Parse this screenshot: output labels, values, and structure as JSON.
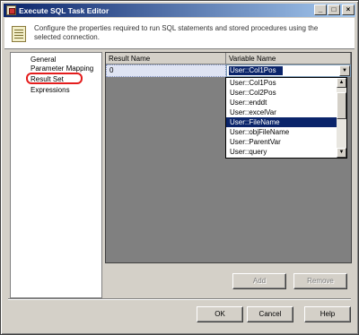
{
  "window": {
    "title": "Execute SQL Task Editor",
    "controls": {
      "minimize": "_",
      "maximize": "□",
      "close": "×"
    }
  },
  "header": {
    "description": "Configure the properties required to run SQL statements and stored procedures using the selected connection.",
    "icon": "task-document-icon"
  },
  "sidebar": {
    "items": [
      {
        "label": "General"
      },
      {
        "label": "Parameter Mapping"
      },
      {
        "label": "Result Set",
        "selected": true,
        "highlight_color": "#e41d1d"
      },
      {
        "label": "Expressions"
      }
    ]
  },
  "grid": {
    "columns": [
      "Result Name",
      "Variable Name"
    ],
    "rows": [
      {
        "result_name": "0",
        "variable_name": "User::Col1Pos"
      }
    ]
  },
  "dropdown": {
    "options": [
      "User::Col1Pos",
      "User::Col2Pos",
      "User::enddt",
      "User::excelVar",
      "User::FileName",
      "User::objFileName",
      "User::ParentVar",
      "User::query"
    ],
    "highlighted": "User::FileName"
  },
  "buttons": {
    "add_label": "Add",
    "remove_label": "Remove",
    "ok_label": "OK",
    "cancel_label": "Cancel",
    "help_label": "Help"
  },
  "colors": {
    "selection": "#0a246a",
    "face": "#d4d0c8",
    "annotation": "#e41d1d"
  }
}
